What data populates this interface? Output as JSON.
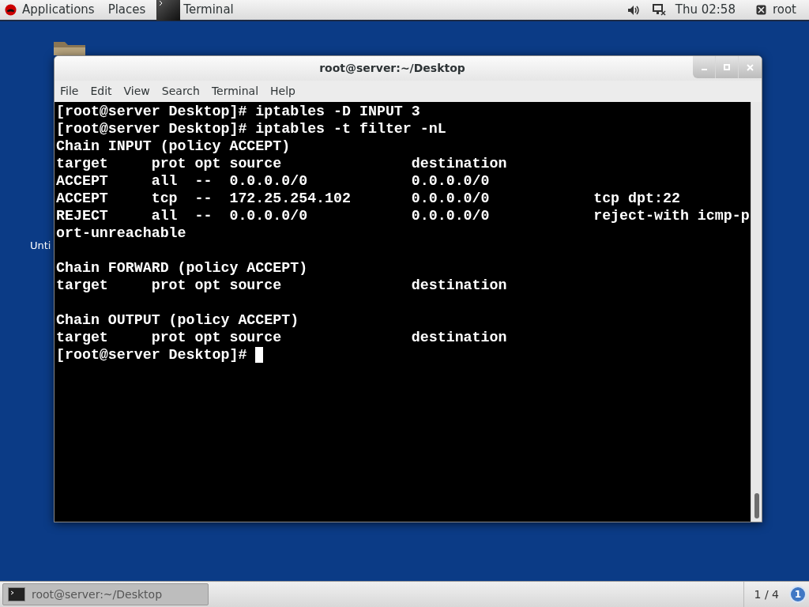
{
  "top_bar": {
    "applications": "Applications",
    "places": "Places",
    "active_app": "Terminal",
    "clock": "Thu 02:58",
    "user": "root"
  },
  "desktop": {
    "icons": [
      {
        "label": "Unti"
      }
    ]
  },
  "window": {
    "title": "root@server:~/Desktop",
    "menu": [
      "File",
      "Edit",
      "View",
      "Search",
      "Terminal",
      "Help"
    ],
    "terminal_blocks": [
      [
        "[root@server Desktop]# iptables -D INPUT 3",
        "[root@server Desktop]# iptables -t filter -nL",
        "Chain INPUT (policy ACCEPT)",
        "target     prot opt source               destination",
        "ACCEPT     all  --  0.0.0.0/0            0.0.0.0/0",
        "ACCEPT     tcp  --  172.25.254.102       0.0.0.0/0            tcp dpt:22",
        "REJECT     all  --  0.0.0.0/0            0.0.0.0/0            reject-with icmp-p",
        "ort-unreachable"
      ],
      [
        "Chain FORWARD (policy ACCEPT)",
        "target     prot opt source               destination"
      ],
      [
        "Chain OUTPUT (policy ACCEPT)",
        "target     prot opt source               destination",
        "[root@server Desktop]# "
      ]
    ],
    "cursor_visible": true
  },
  "bottom_bar": {
    "tasks": [
      {
        "label": "root@server:~/Desktop",
        "selected": true
      }
    ],
    "workspace": "1 / 4",
    "notifications": "1"
  }
}
